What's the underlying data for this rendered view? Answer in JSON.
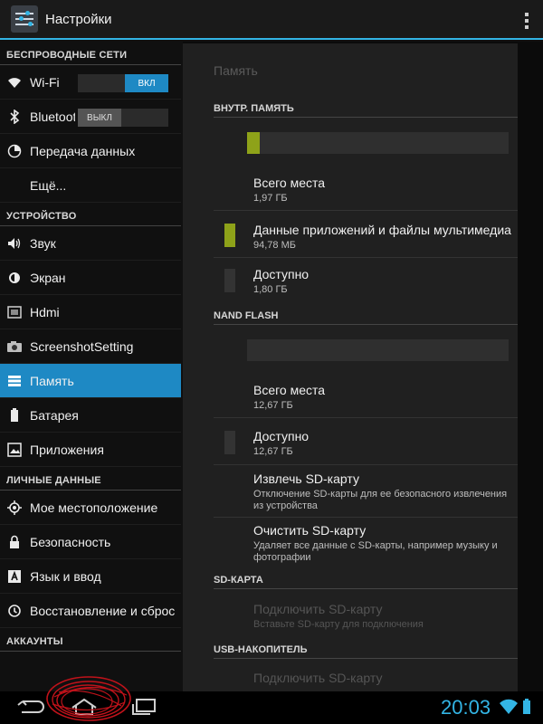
{
  "header": {
    "title": "Настройки"
  },
  "sidebar": {
    "sections": [
      {
        "label": "БЕСПРОВОДНЫЕ СЕТИ",
        "items": [
          {
            "label": "Wi-Fi",
            "icon": "wifi-icon",
            "toggle": "ВКЛ"
          },
          {
            "label": "Bluetooth",
            "icon": "bluetooth-icon",
            "toggle": "ВЫКЛ"
          },
          {
            "label": "Передача данных",
            "icon": "data-usage-icon"
          },
          {
            "label": "Ещё..."
          }
        ]
      },
      {
        "label": "УСТРОЙСТВО",
        "items": [
          {
            "label": "Звук",
            "icon": "sound-icon"
          },
          {
            "label": "Экран",
            "icon": "display-icon"
          },
          {
            "label": "Hdmi",
            "icon": "hdmi-icon"
          },
          {
            "label": "ScreenshotSetting",
            "icon": "camera-icon"
          },
          {
            "label": "Память",
            "icon": "storage-icon",
            "active": true
          },
          {
            "label": "Батарея",
            "icon": "battery-icon"
          },
          {
            "label": "Приложения",
            "icon": "apps-icon"
          }
        ]
      },
      {
        "label": "ЛИЧНЫЕ ДАННЫЕ",
        "items": [
          {
            "label": "Мое местоположение",
            "icon": "location-icon"
          },
          {
            "label": "Безопасность",
            "icon": "lock-icon"
          },
          {
            "label": "Язык и ввод",
            "icon": "language-icon"
          },
          {
            "label": "Восстановление и сброс",
            "icon": "backup-icon"
          }
        ]
      },
      {
        "label": "АККАУНТЫ",
        "items": []
      }
    ]
  },
  "main": {
    "title": "Память",
    "internal": {
      "header": "ВНУТР. ПАМЯТЬ",
      "usage_fraction": 0.048,
      "total": {
        "title": "Всего места",
        "value": "1,97 ГБ"
      },
      "apps": {
        "title": "Данные приложений и файлы мультимедиа",
        "value": "94,78 МБ",
        "color": "#8ea219"
      },
      "available": {
        "title": "Доступно",
        "value": "1,80 ГБ"
      }
    },
    "nand": {
      "header": "NAND FLASH",
      "usage_fraction": 0,
      "total": {
        "title": "Всего места",
        "value": "12,67 ГБ"
      },
      "available": {
        "title": "Доступно",
        "value": "12,67 ГБ"
      },
      "eject": {
        "title": "Извлечь SD-карту",
        "summary": "Отключение SD-карты для ее безопасного извлечения из устройства"
      },
      "erase": {
        "title": "Очистить SD-карту",
        "summary": "Удаляет все данные с SD-карты, например музыку и фотографии"
      }
    },
    "sd": {
      "header": "SD-КАРТА",
      "mount": {
        "title": "Подключить SD-карту",
        "summary": "Вставьте SD-карту для подключения"
      }
    },
    "usb": {
      "header": "USB-НАКОПИТЕЛЬ",
      "mount": {
        "title": "Подключить SD-карту"
      }
    }
  },
  "statusbar": {
    "time": "20:03",
    "accent": "#33b5e5"
  }
}
